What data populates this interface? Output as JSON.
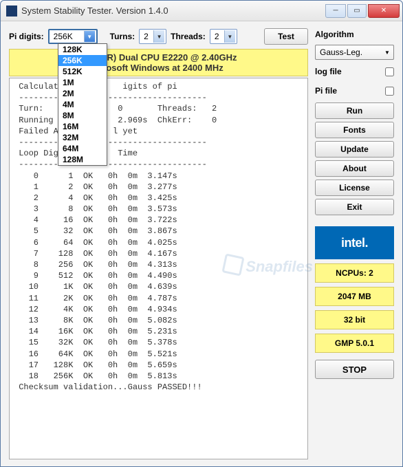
{
  "window": {
    "title": "System Stability Tester. Version 1.4.0"
  },
  "toprow": {
    "pi_label": "Pi digits:",
    "pi_value": "256K",
    "turns_label": "Turns:",
    "turns_value": "2",
    "threads_label": "Threads:",
    "threads_value": "2",
    "test_btn": "Test"
  },
  "pi_options": [
    "128K",
    "256K",
    "512K",
    "1M",
    "2M",
    "4M",
    "8M",
    "16M",
    "32M",
    "64M",
    "128M"
  ],
  "pi_selected_index": 1,
  "cpu_banner_line1": "Intel(         (R) Dual  CPU  E2220  @ 2.40GHz",
  "cpu_banner_line2": "R          rosoft Windows at 2400 MHz",
  "console_header": " Calculating          igits of pi\n --------------------------------------\n Turn:   8           0       Threads:   2\n Running For:        2.969s  ChkErr:    0\n Failed Afte        l yet\n --------------------------------------\n Loop Digits         Time\n --------------------------------------",
  "rows": [
    {
      "loop": 0,
      "digits": "1",
      "state": "OK",
      "h": "0h",
      "m": "0m",
      "t": "3.147s"
    },
    {
      "loop": 1,
      "digits": "2",
      "state": "OK",
      "h": "0h",
      "m": "0m",
      "t": "3.277s"
    },
    {
      "loop": 2,
      "digits": "4",
      "state": "OK",
      "h": "0h",
      "m": "0m",
      "t": "3.425s"
    },
    {
      "loop": 3,
      "digits": "8",
      "state": "OK",
      "h": "0h",
      "m": "0m",
      "t": "3.573s"
    },
    {
      "loop": 4,
      "digits": "16",
      "state": "OK",
      "h": "0h",
      "m": "0m",
      "t": "3.722s"
    },
    {
      "loop": 5,
      "digits": "32",
      "state": "OK",
      "h": "0h",
      "m": "0m",
      "t": "3.867s"
    },
    {
      "loop": 6,
      "digits": "64",
      "state": "OK",
      "h": "0h",
      "m": "0m",
      "t": "4.025s"
    },
    {
      "loop": 7,
      "digits": "128",
      "state": "OK",
      "h": "0h",
      "m": "0m",
      "t": "4.167s"
    },
    {
      "loop": 8,
      "digits": "256",
      "state": "OK",
      "h": "0h",
      "m": "0m",
      "t": "4.313s"
    },
    {
      "loop": 9,
      "digits": "512",
      "state": "OK",
      "h": "0h",
      "m": "0m",
      "t": "4.490s"
    },
    {
      "loop": 10,
      "digits": "1K",
      "state": "OK",
      "h": "0h",
      "m": "0m",
      "t": "4.639s"
    },
    {
      "loop": 11,
      "digits": "2K",
      "state": "OK",
      "h": "0h",
      "m": "0m",
      "t": "4.787s"
    },
    {
      "loop": 12,
      "digits": "4K",
      "state": "OK",
      "h": "0h",
      "m": "0m",
      "t": "4.934s"
    },
    {
      "loop": 13,
      "digits": "8K",
      "state": "OK",
      "h": "0h",
      "m": "0m",
      "t": "5.082s"
    },
    {
      "loop": 14,
      "digits": "16K",
      "state": "OK",
      "h": "0h",
      "m": "0m",
      "t": "5.231s"
    },
    {
      "loop": 15,
      "digits": "32K",
      "state": "OK",
      "h": "0h",
      "m": "0m",
      "t": "5.378s"
    },
    {
      "loop": 16,
      "digits": "64K",
      "state": "OK",
      "h": "0h",
      "m": "0m",
      "t": "5.521s"
    },
    {
      "loop": 17,
      "digits": "128K",
      "state": "OK",
      "h": "0h",
      "m": "0m",
      "t": "5.659s"
    },
    {
      "loop": 18,
      "digits": "256K",
      "state": "OK",
      "h": "0h",
      "m": "0m",
      "t": "5.813s"
    }
  ],
  "footer_line": " Checksum validation...Gauss PASSED!!!",
  "side": {
    "algorithm_label": "Algorithm",
    "algorithm_value": "Gauss-Leg.",
    "logfile_label": "log file",
    "pifile_label": "Pi file",
    "buttons": [
      "Run",
      "Fonts",
      "Update",
      "About",
      "License",
      "Exit"
    ],
    "intel": "intel",
    "ncpus": "NCPUs: 2",
    "mem": "2047 MB",
    "arch": "32 bit",
    "gmp": "GMP 5.0.1",
    "stop": "STOP"
  },
  "watermark": "Snapfiles"
}
